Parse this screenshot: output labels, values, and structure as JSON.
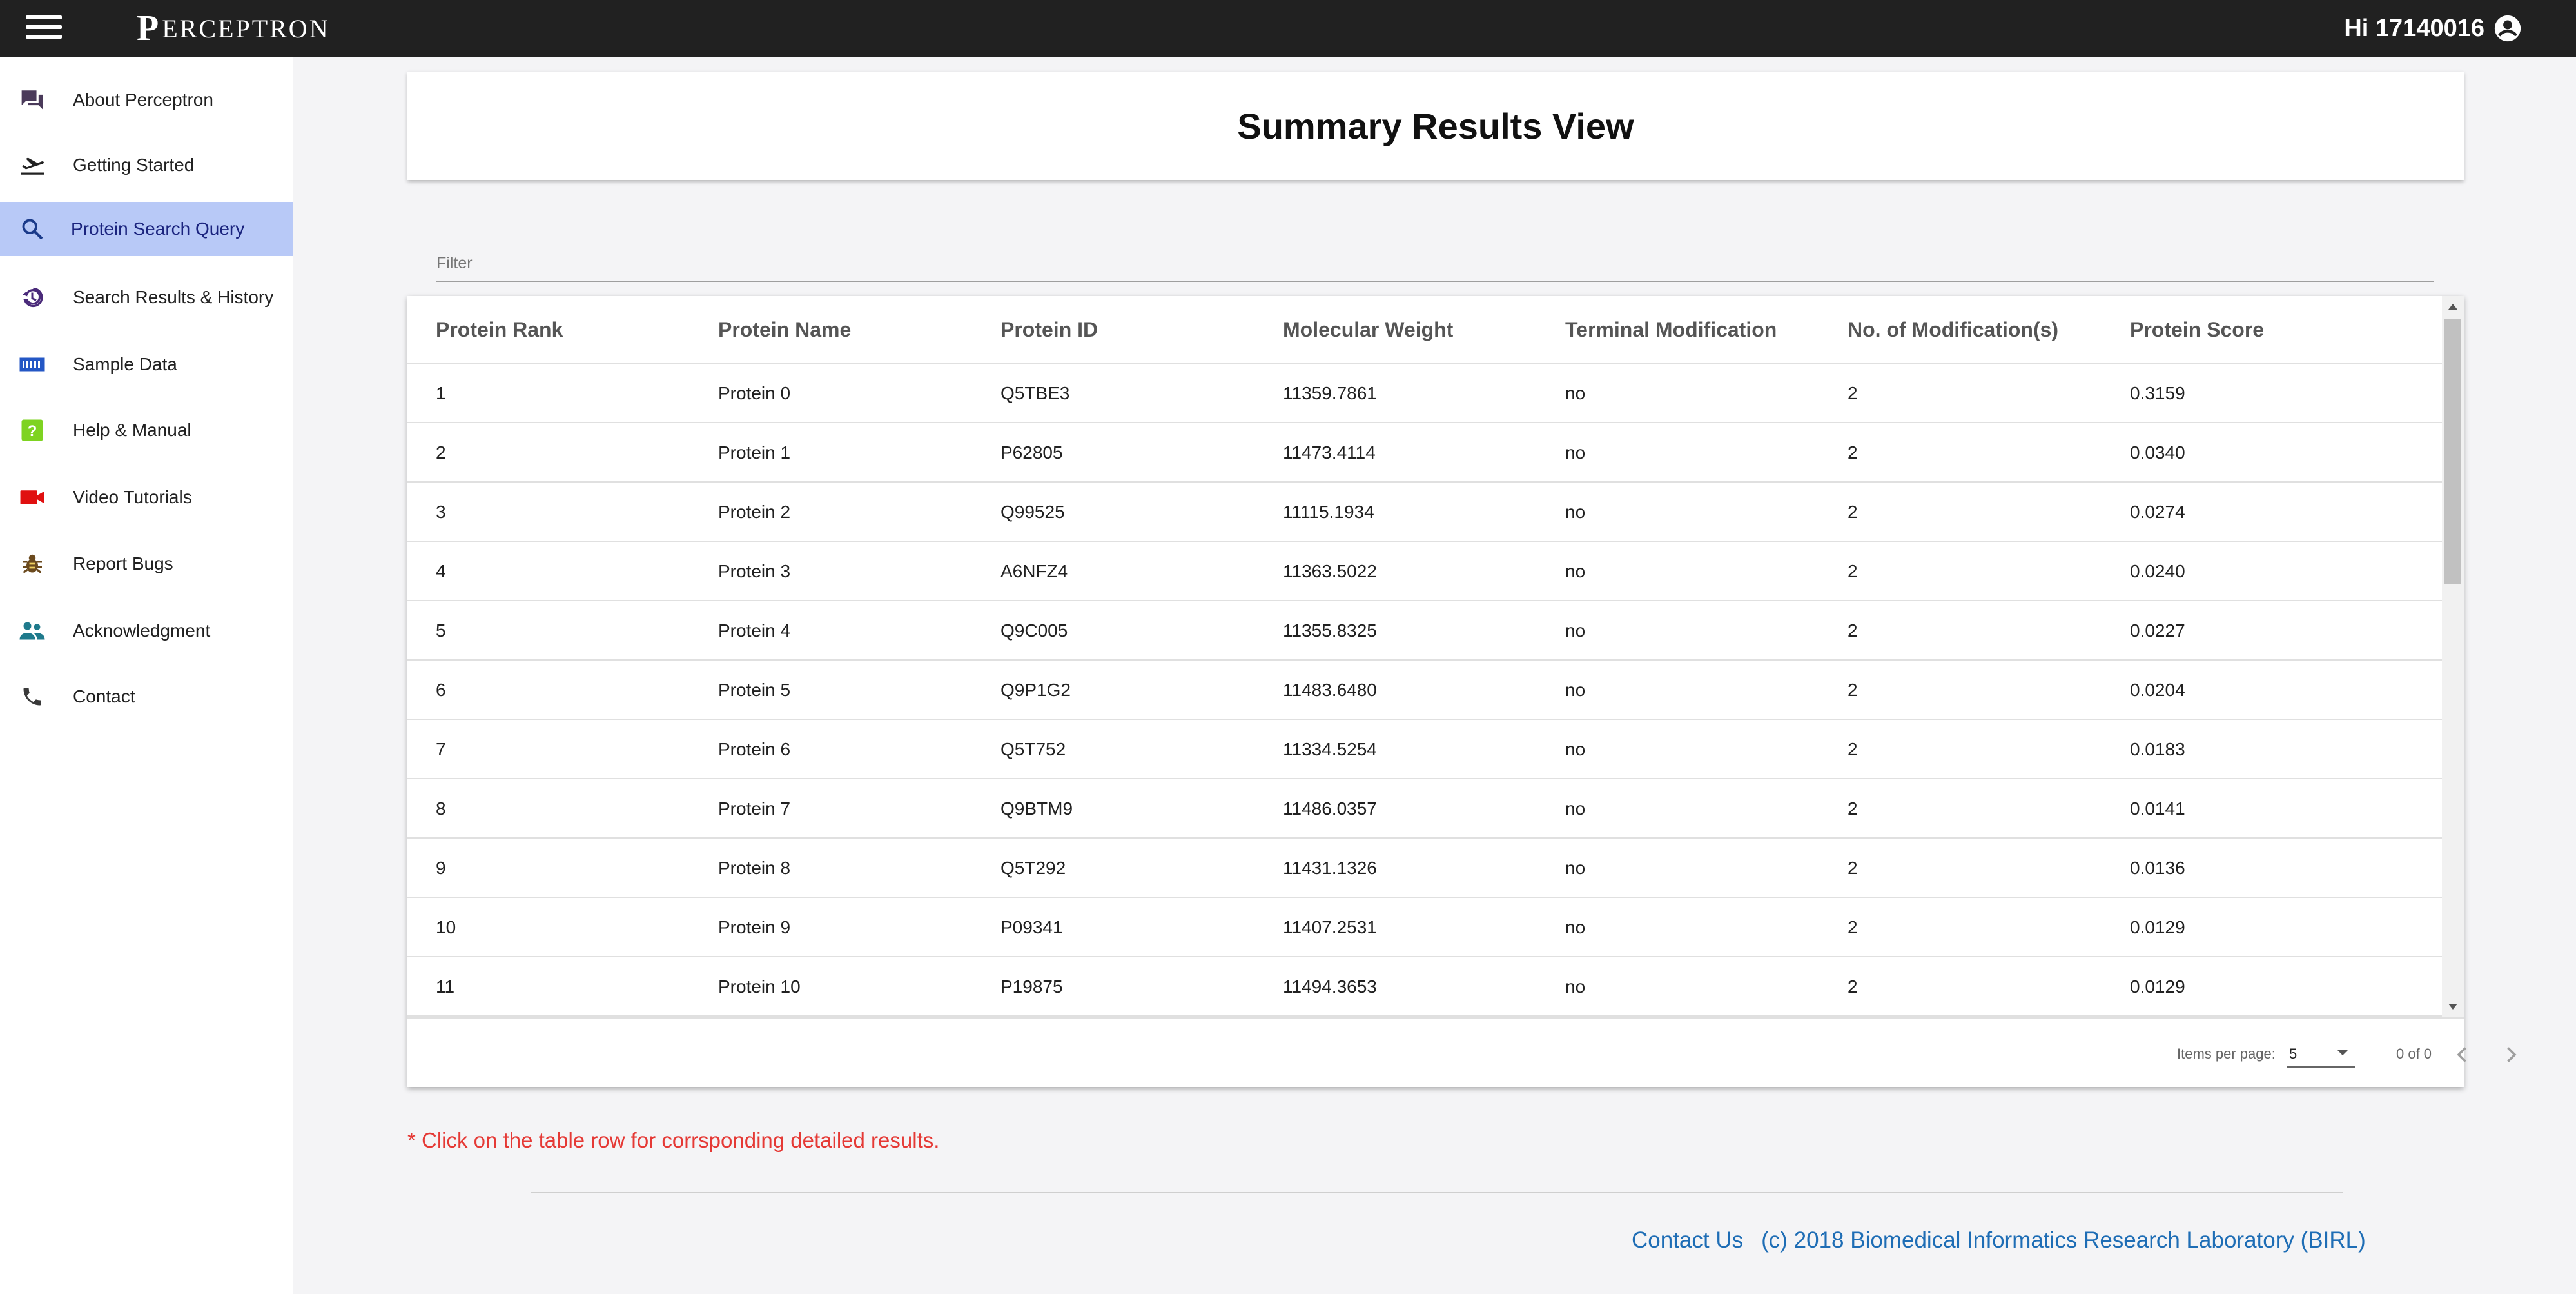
{
  "header": {
    "brand": "PERCEPTRON",
    "brand_mark": "P",
    "brand_rest": "ERCEPTRON",
    "user_greeting": "Hi 17140016"
  },
  "sidebar": {
    "items": [
      {
        "label": "About Perceptron",
        "icon": "chat-icon",
        "active": false
      },
      {
        "label": "Getting Started",
        "icon": "airplane-takeoff-icon",
        "active": false
      },
      {
        "label": "Protein Search Query",
        "icon": "search-icon",
        "active": true
      },
      {
        "label": "Search Results & History",
        "icon": "history-icon",
        "active": false
      },
      {
        "label": "Sample Data",
        "icon": "data-strip-icon",
        "active": false
      },
      {
        "label": "Help & Manual",
        "icon": "help-icon",
        "active": false
      },
      {
        "label": "Video Tutorials",
        "icon": "videocam-icon",
        "active": false
      },
      {
        "label": "Report Bugs",
        "icon": "bug-icon",
        "active": false
      },
      {
        "label": "Acknowledgment",
        "icon": "people-icon",
        "active": false
      },
      {
        "label": "Contact",
        "icon": "phone-icon",
        "active": false
      }
    ]
  },
  "main": {
    "title": "Summary Results View",
    "filter_placeholder": "Filter",
    "table": {
      "columns": [
        "Protein Rank",
        "Protein Name",
        "Protein ID",
        "Molecular Weight",
        "Terminal Modification",
        "No. of Modification(s)",
        "Protein Score"
      ],
      "rows": [
        [
          "1",
          "Protein 0",
          "Q5TBE3",
          "11359.7861",
          "no",
          "2",
          "0.3159"
        ],
        [
          "2",
          "Protein 1",
          "P62805",
          "11473.4114",
          "no",
          "2",
          "0.0340"
        ],
        [
          "3",
          "Protein 2",
          "Q99525",
          "11115.1934",
          "no",
          "2",
          "0.0274"
        ],
        [
          "4",
          "Protein 3",
          "A6NFZ4",
          "11363.5022",
          "no",
          "2",
          "0.0240"
        ],
        [
          "5",
          "Protein 4",
          "Q9C005",
          "11355.8325",
          "no",
          "2",
          "0.0227"
        ],
        [
          "6",
          "Protein 5",
          "Q9P1G2",
          "11483.6480",
          "no",
          "2",
          "0.0204"
        ],
        [
          "7",
          "Protein 6",
          "Q5T752",
          "11334.5254",
          "no",
          "2",
          "0.0183"
        ],
        [
          "8",
          "Protein 7",
          "Q9BTM9",
          "11486.0357",
          "no",
          "2",
          "0.0141"
        ],
        [
          "9",
          "Protein 8",
          "Q5T292",
          "11431.1326",
          "no",
          "2",
          "0.0136"
        ],
        [
          "10",
          "Protein 9",
          "P09341",
          "11407.2531",
          "no",
          "2",
          "0.0129"
        ],
        [
          "11",
          "Protein 10",
          "P19875",
          "11494.3653",
          "no",
          "2",
          "0.0129"
        ]
      ]
    },
    "paginator": {
      "items_per_page_label": "Items per page:",
      "items_per_page_value": "5",
      "range": "0 of 0"
    },
    "note": "* Click on the table row for corrsponding detailed results.",
    "footer": {
      "contact": "Contact Us",
      "copyright": "(c) 2018 Biomedical Informatics Research Laboratory (BIRL)"
    }
  },
  "colors": {
    "topbar": "#212121",
    "active_nav": "#b8c9f7",
    "note_red": "#e53935",
    "footer_link": "#1e6db5"
  }
}
